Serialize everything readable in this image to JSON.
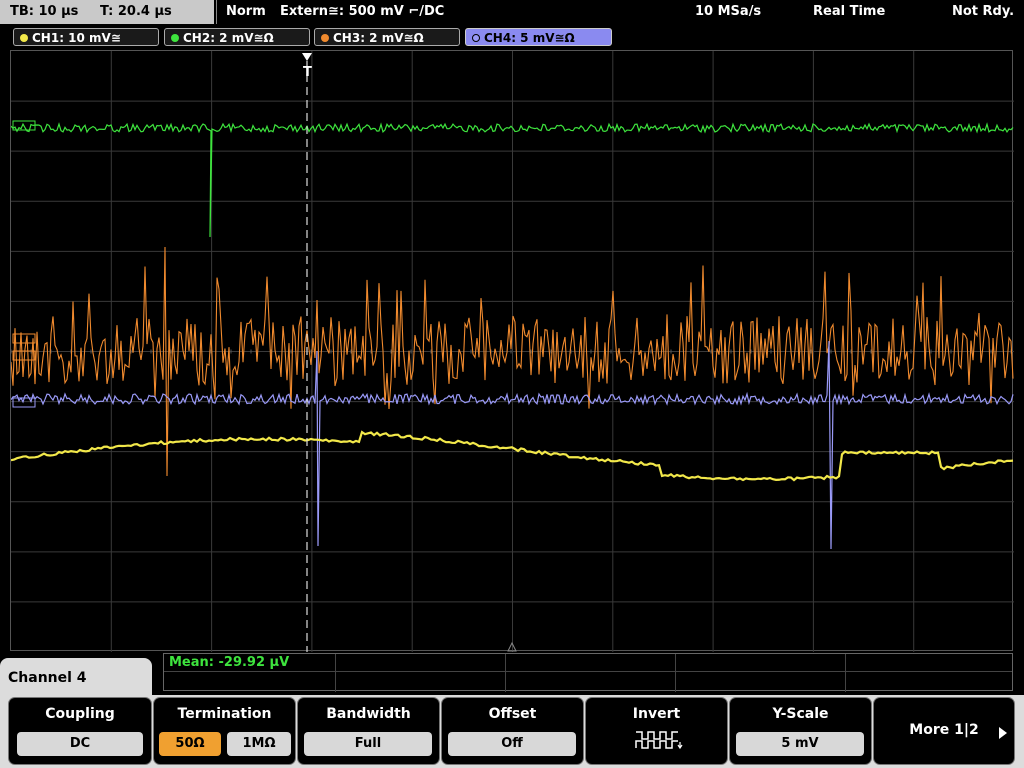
{
  "status": {
    "timebase": "TB: 10 µs",
    "trigger_time": "T: 20.4 µs",
    "mode": "Norm",
    "trigger_source": "Extern≅: 500 mV ⌐/DC",
    "sample_rate": "10 MSa/s",
    "acq_mode": "Real Time",
    "state": "Not Rdy."
  },
  "channels": [
    {
      "label": "CH1: 10 mV≅",
      "color": "#f2e84a"
    },
    {
      "label": "CH2: 2 mV≅Ω",
      "color": "#3ee43e"
    },
    {
      "label": "CH3: 2 mV≅Ω",
      "color": "#f08a2e"
    },
    {
      "label": "CH4: 5 mV≅Ω",
      "color": "#9a9af8"
    }
  ],
  "trigger_marker": "T",
  "measurement": {
    "mean": "Mean: -29.92 µV"
  },
  "menu": {
    "channel_label": "Channel 4",
    "coupling": {
      "title": "Coupling",
      "value": "DC"
    },
    "termination": {
      "title": "Termination",
      "opt1": "50Ω",
      "opt2": "1MΩ"
    },
    "bandwidth": {
      "title": "Bandwidth",
      "value": "Full"
    },
    "offset": {
      "title": "Offset",
      "value": "Off"
    },
    "invert": {
      "title": "Invert",
      "icon": "invert-square-wave-icon"
    },
    "yscale": {
      "title": "Y-Scale",
      "value": "5 mV"
    },
    "more": {
      "label": "More 1|2",
      "icon": "play-arrow-icon"
    }
  },
  "colors": {
    "grid": "#3a3a3a",
    "ch1": "#f2e84a",
    "ch2": "#3ee43e",
    "ch3": "#f08a2e",
    "ch4": "#9a9af8"
  }
}
